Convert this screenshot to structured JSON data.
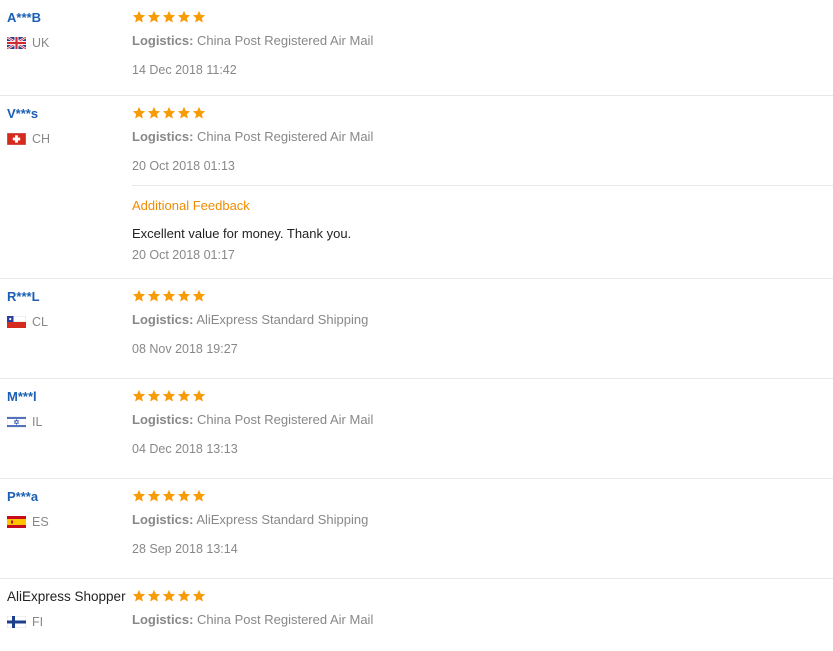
{
  "colors": {
    "star": "#f79c06",
    "username": "#1a5fb4",
    "accent_orange": "#f08c00",
    "meta_gray": "#888888",
    "divider": "#e8e8e8"
  },
  "icons": {
    "star": "star-icon",
    "flag": "country-flag-icon"
  },
  "logistics_label": "Logistics:",
  "reviews": [
    {
      "user": "A***B",
      "country": "UK",
      "rating": 5,
      "logistics": "China Post Registered Air Mail",
      "date": "14 Dec 2018 11:42"
    },
    {
      "user": "V***s",
      "country": "CH",
      "rating": 5,
      "logistics": "China Post Registered Air Mail",
      "date": "20 Oct 2018 01:13",
      "additional": {
        "title": "Additional Feedback",
        "text": "Excellent value for money. Thank you.",
        "date": "20 Oct 2018 01:17"
      }
    },
    {
      "user": "R***L",
      "country": "CL",
      "rating": 5,
      "logistics": "AliExpress Standard Shipping",
      "date": "08 Nov 2018 19:27"
    },
    {
      "user": "M***l",
      "country": "IL",
      "rating": 5,
      "logistics": "China Post Registered Air Mail",
      "date": "04 Dec 2018 13:13"
    },
    {
      "user": "P***a",
      "country": "ES",
      "rating": 5,
      "logistics": "AliExpress Standard Shipping",
      "date": "28 Sep 2018 13:14"
    },
    {
      "user": "AliExpress Shopper",
      "country": "FI",
      "rating": 5,
      "logistics": "China Post Registered Air Mail",
      "date": ""
    }
  ]
}
